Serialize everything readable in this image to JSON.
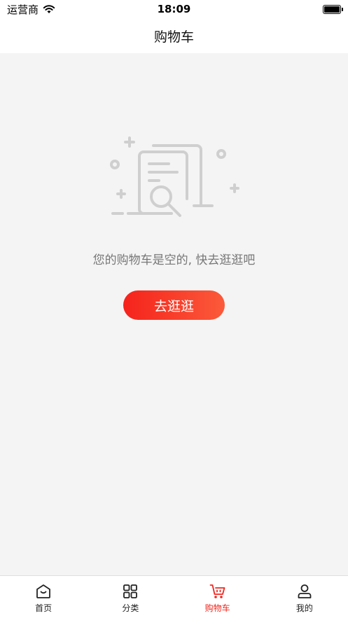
{
  "status_bar": {
    "carrier": "运营商",
    "time": "18:09"
  },
  "header": {
    "title": "购物车"
  },
  "empty_state": {
    "message": "您的购物车是空的, 快去逛逛吧",
    "button_label": "去逛逛"
  },
  "tab_bar": {
    "items": [
      {
        "label": "首页",
        "icon": "home-icon",
        "active": false
      },
      {
        "label": "分类",
        "icon": "grid-icon",
        "active": false
      },
      {
        "label": "购物车",
        "icon": "cart-icon",
        "active": true
      },
      {
        "label": "我的",
        "icon": "user-icon",
        "active": false
      }
    ],
    "active_color": "#f2251d",
    "inactive_color": "#222222"
  },
  "colors": {
    "accent": "#f5231c",
    "background": "#f4f4f4"
  }
}
